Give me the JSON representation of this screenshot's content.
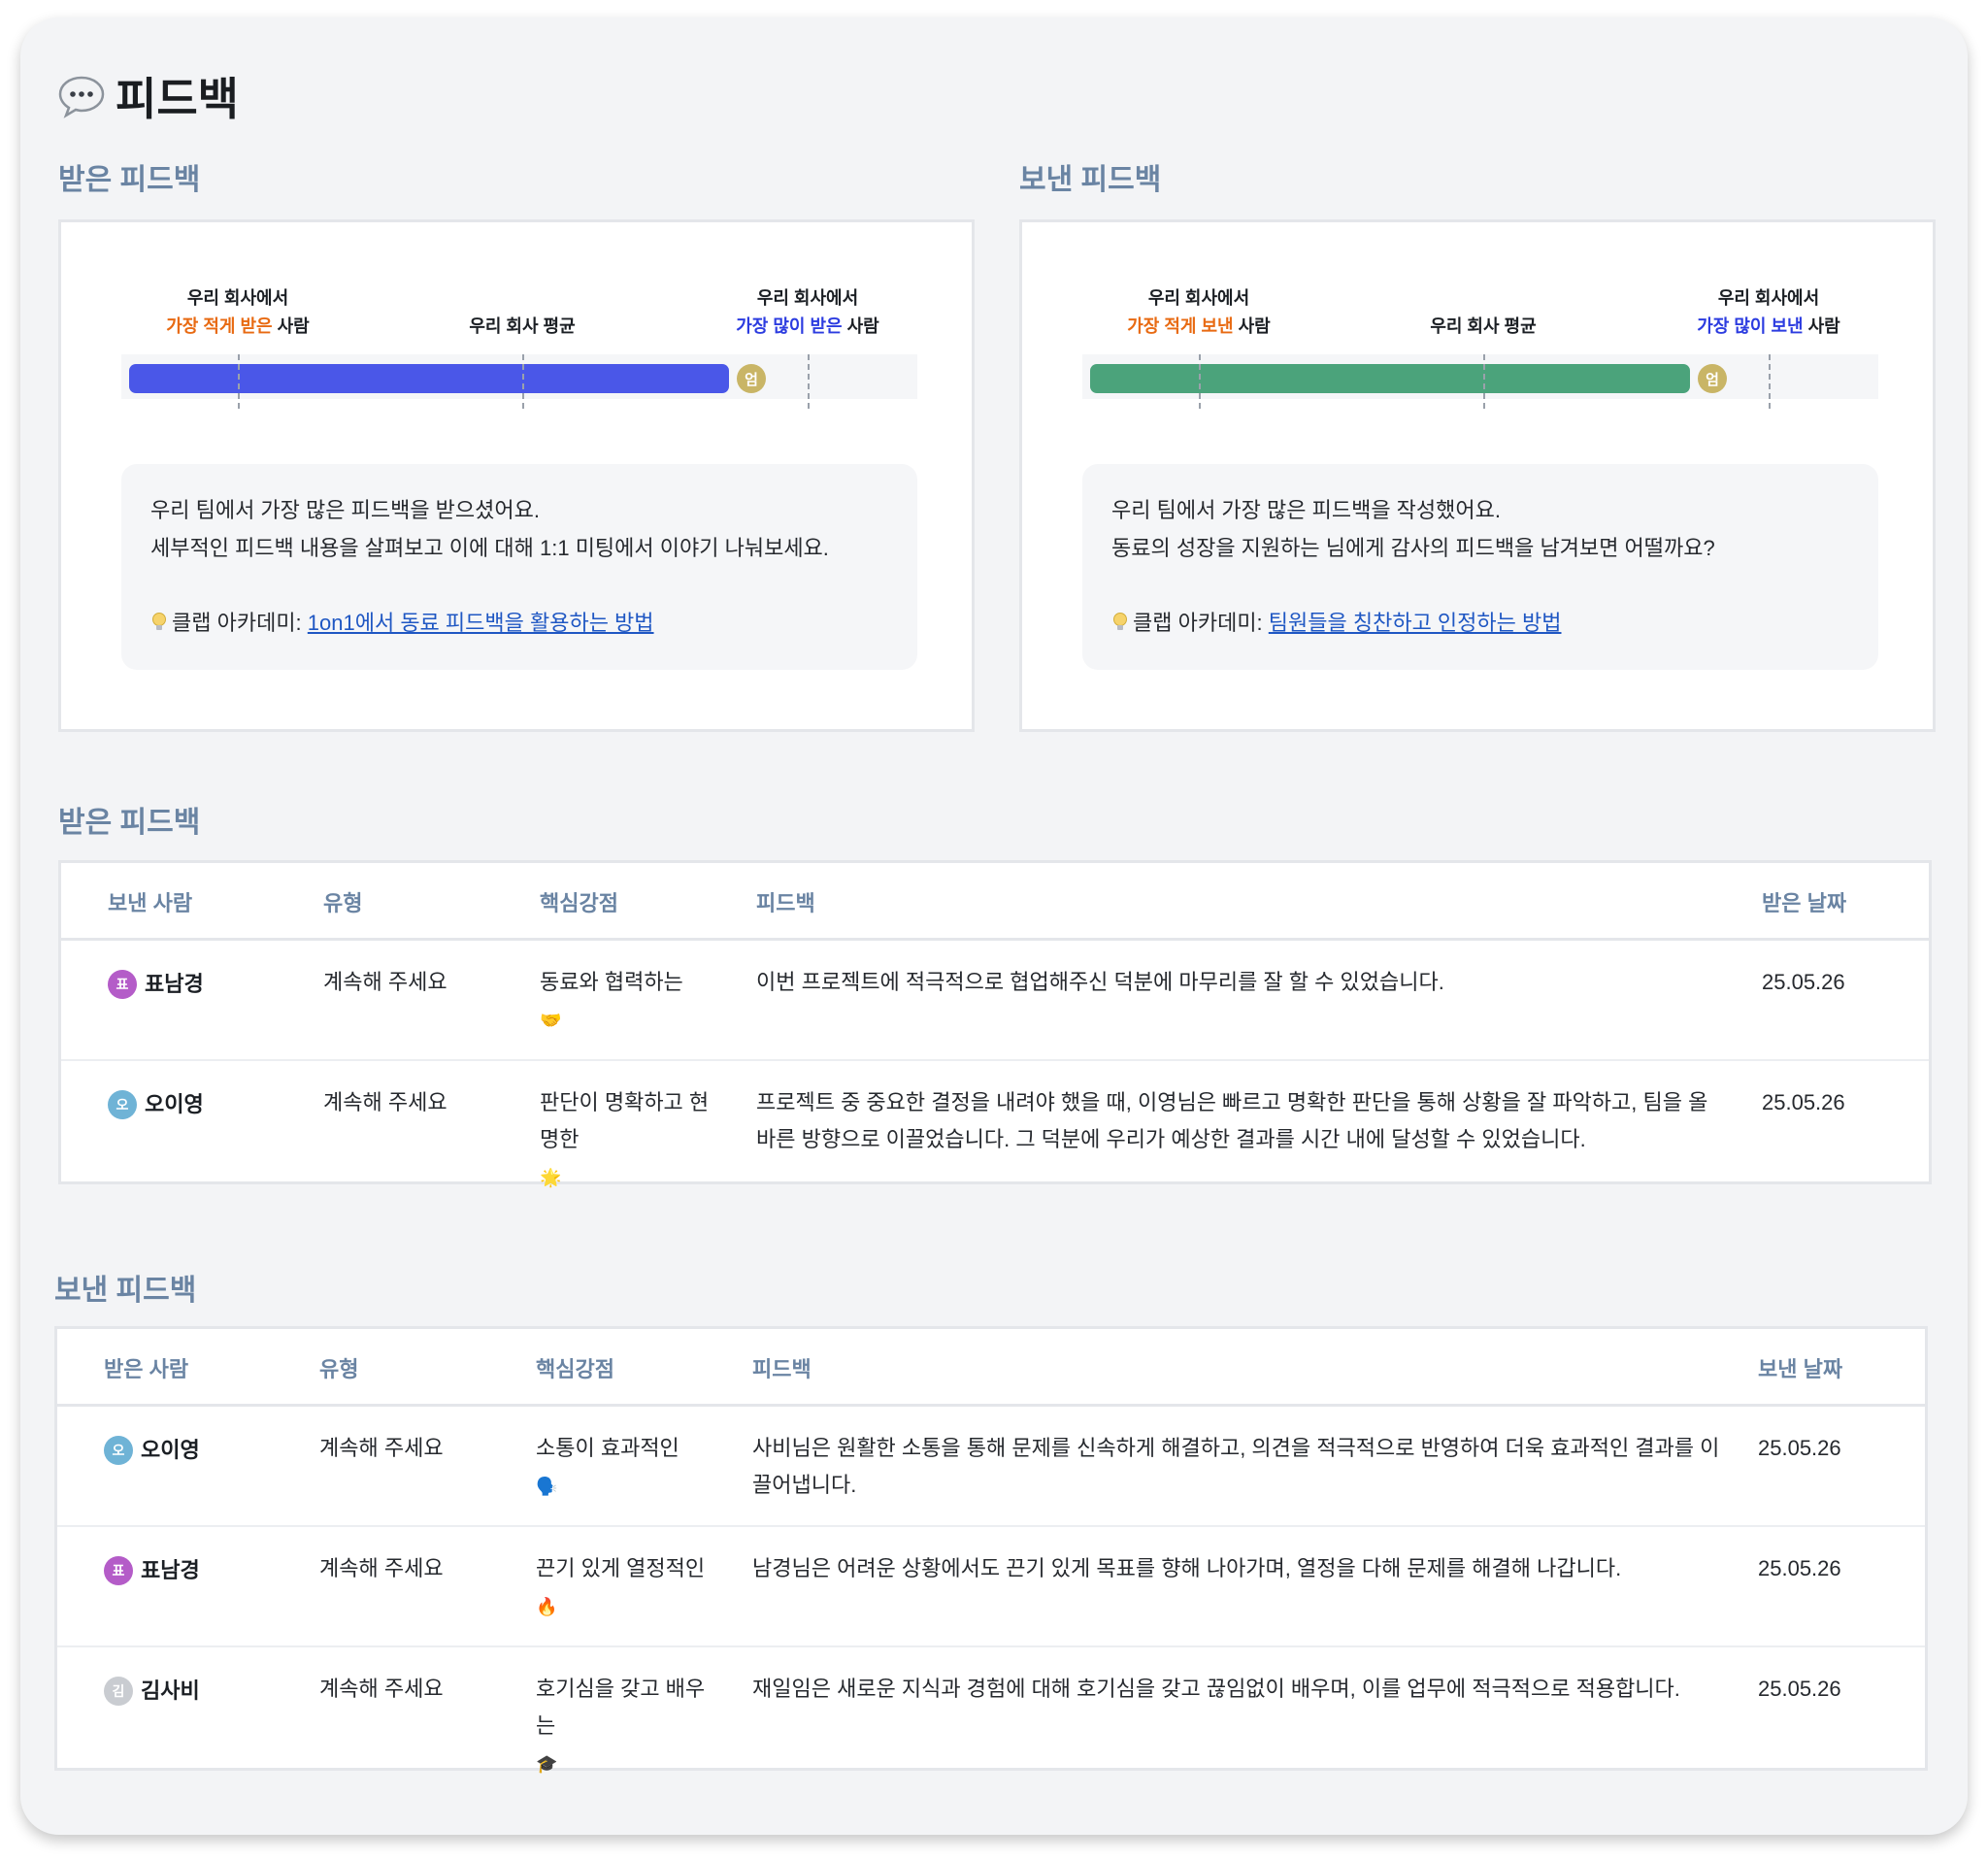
{
  "page": {
    "title": "피드백",
    "title_icon": "speech-bubble-icon"
  },
  "summary": {
    "received": {
      "section_title": "받은 피드백",
      "marker_left_line1": "우리 회사에서",
      "marker_left_highlight": "가장 적게 받은",
      "marker_left_suffix": " 사람",
      "marker_avg": "우리 회사 평균",
      "marker_right_line1": "우리 회사에서",
      "marker_right_highlight": "가장 많이 받은",
      "marker_right_suffix": " 사람",
      "bar_color": "#4a57e8",
      "bar_level": 0.93,
      "avatar_initial": "엄",
      "note_line1": "우리 팀에서 가장 많은 피드백을 받으셨어요.",
      "note_line2": "세부적인 피드백 내용을 살펴보고 이에 대해 1:1 미팅에서 이야기 나눠보세요.",
      "academy_prefix": "클랩 아카데미: ",
      "academy_link": "1on1에서 동료 피드백을 활용하는 방법"
    },
    "sent": {
      "section_title": "보낸 피드백",
      "marker_left_line1": "우리 회사에서",
      "marker_left_highlight": "가장 적게 보낸",
      "marker_left_suffix": " 사람",
      "marker_avg": "우리 회사 평균",
      "marker_right_line1": "우리 회사에서",
      "marker_right_highlight": "가장 많이 보낸",
      "marker_right_suffix": " 사람",
      "bar_color": "#4ba37b",
      "bar_level": 0.93,
      "avatar_initial": "엄",
      "note_line1": "우리 팀에서 가장 많은 피드백을 작성했어요.",
      "note_line2": "동료의 성장을 지원하는 님에게 감사의 피드백을 남겨보면 어떨까요?",
      "academy_prefix": "클랩 아카데미: ",
      "academy_link": "팀원들을 칭찬하고 인정하는 방법"
    }
  },
  "received_table": {
    "section_title": "받은 피드백",
    "headers": {
      "person": "보낸 사람",
      "type": "유형",
      "strength": "핵심강점",
      "feedback": "피드백",
      "date": "받은 날짜"
    },
    "rows": [
      {
        "initial": "표",
        "avatar_color": "#b45cc8",
        "name": "표남경",
        "type": "계속해 주세요",
        "strength": "동료와 협력하는",
        "emoji": "🤝",
        "feedback": "이번 프로젝트에 적극적으로 협업해주신 덕분에 마무리를 잘 할 수 있었습니다.",
        "date": "25.05.26"
      },
      {
        "initial": "오",
        "avatar_color": "#6fb3d6",
        "name": "오이영",
        "type": "계속해 주세요",
        "strength": "판단이 명확하고 현명한",
        "emoji": "🌟",
        "feedback": "프로젝트 중 중요한 결정을 내려야 했을 때, 이영님은 빠르고 명확한 판단을 통해 상황을 잘 파악하고, 팀을 올바른 방향으로 이끌었습니다. 그 덕분에 우리가 예상한 결과를 시간 내에 달성할 수 있었습니다.",
        "date": "25.05.26"
      }
    ]
  },
  "sent_table": {
    "section_title": "보낸 피드백",
    "headers": {
      "person": "받은 사람",
      "type": "유형",
      "strength": "핵심강점",
      "feedback": "피드백",
      "date": "보낸 날짜"
    },
    "rows": [
      {
        "initial": "오",
        "avatar_color": "#6fb3d6",
        "name": "오이영",
        "type": "계속해 주세요",
        "strength": "소통이 효과적인",
        "emoji": "🗣️",
        "feedback": "사비님은 원활한 소통을 통해 문제를 신속하게 해결하고, 의견을 적극적으로 반영하여 더욱 효과적인 결과를 이끌어냅니다.",
        "date": "25.05.26"
      },
      {
        "initial": "표",
        "avatar_color": "#b45cc8",
        "name": "표남경",
        "type": "계속해 주세요",
        "strength": "끈기 있게 열정적인",
        "emoji": "🔥",
        "feedback": "남경님은 어려운 상황에서도 끈기 있게 목표를 향해 나아가며, 열정을 다해 문제를 해결해 나갑니다.",
        "date": "25.05.26"
      },
      {
        "initial": "김",
        "avatar_color": "#c9ccd1",
        "name": "김사비",
        "type": "계속해 주세요",
        "strength": "호기심을 갖고 배우는",
        "emoji": "🎓",
        "feedback": "재일임은 새로운 지식과 경험에 대해 호기심을 갖고 끊임없이 배우며, 이를 업무에 적극적으로 적용합니다.",
        "date": "25.05.26"
      }
    ]
  }
}
